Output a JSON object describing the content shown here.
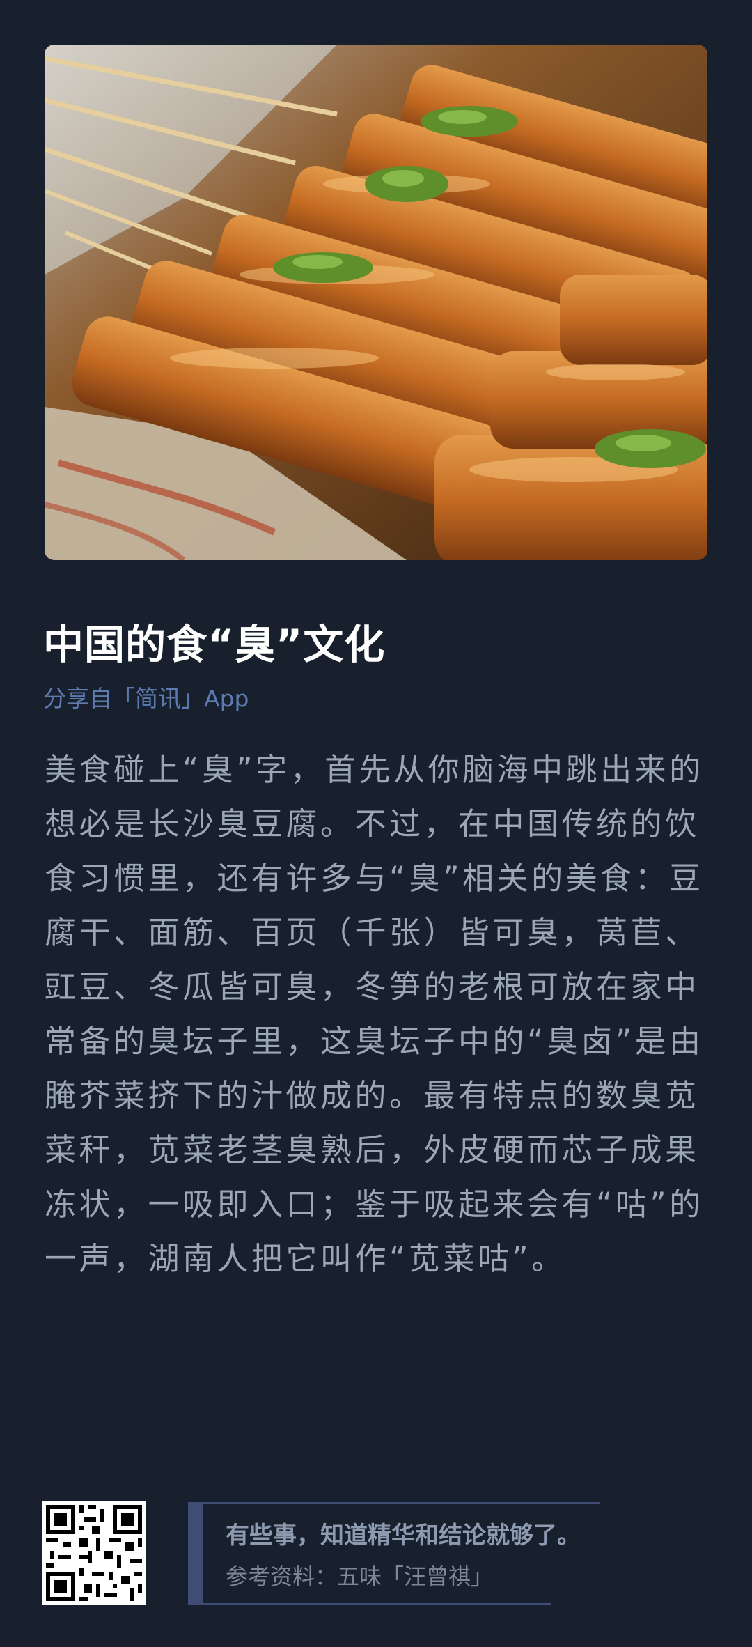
{
  "article": {
    "title": "中国的食“臭”文化",
    "source": "分享自「简讯」App",
    "body": "美食碰上“臭”字，首先从你脑海中跳出来的想必是长沙臭豆腐。不过，在中国传统的饮食习惯里，还有许多与“臭”相关的美食：豆腐干、面筋、百页（千张）皆可臭，莴苣、豇豆、冬瓜皆可臭，冬笋的老根可放在家中常备的臭坛子里，这臭坛子中的“臭卤”是由腌芥菜挤下的汁做成的。最有特点的数臭苋菜秆，苋菜老茎臭熟后，外皮硬而芯子成果冻状，一吸即入口；鉴于吸起来会有“咕”的一声，湖南人把它叫作“苋菜咕”。"
  },
  "footer": {
    "tagline": "有些事，知道精华和结论就够了。",
    "reference": "参考资料：五味「汪曾祺」"
  },
  "colors": {
    "background": "#17202c",
    "accent": "#3f4d75",
    "source_text": "#5d7bb0",
    "body_text": "#9ca7b6"
  }
}
